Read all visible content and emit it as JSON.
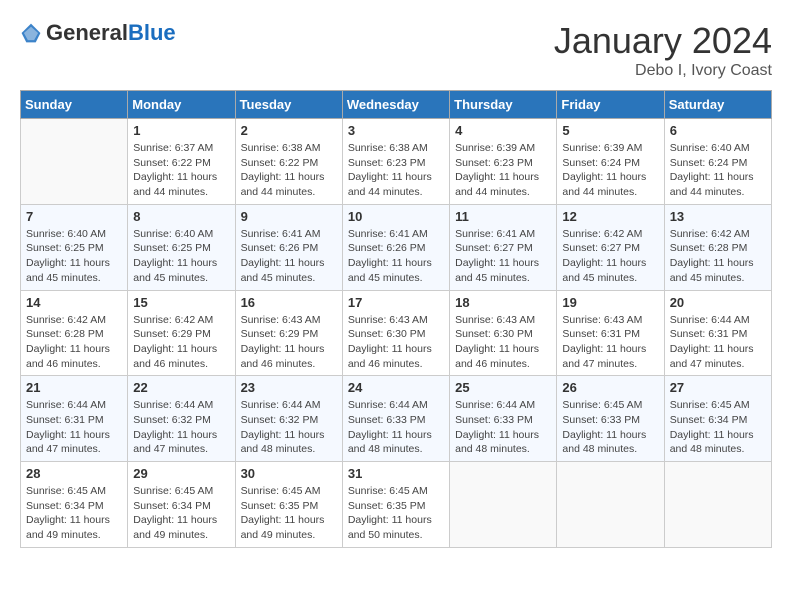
{
  "logo": {
    "text_general": "General",
    "text_blue": "Blue"
  },
  "header": {
    "month": "January 2024",
    "location": "Debo I, Ivory Coast"
  },
  "weekdays": [
    "Sunday",
    "Monday",
    "Tuesday",
    "Wednesday",
    "Thursday",
    "Friday",
    "Saturday"
  ],
  "weeks": [
    [
      {
        "day": "",
        "info": ""
      },
      {
        "day": "1",
        "info": "Sunrise: 6:37 AM\nSunset: 6:22 PM\nDaylight: 11 hours and 44 minutes."
      },
      {
        "day": "2",
        "info": "Sunrise: 6:38 AM\nSunset: 6:22 PM\nDaylight: 11 hours and 44 minutes."
      },
      {
        "day": "3",
        "info": "Sunrise: 6:38 AM\nSunset: 6:23 PM\nDaylight: 11 hours and 44 minutes."
      },
      {
        "day": "4",
        "info": "Sunrise: 6:39 AM\nSunset: 6:23 PM\nDaylight: 11 hours and 44 minutes."
      },
      {
        "day": "5",
        "info": "Sunrise: 6:39 AM\nSunset: 6:24 PM\nDaylight: 11 hours and 44 minutes."
      },
      {
        "day": "6",
        "info": "Sunrise: 6:40 AM\nSunset: 6:24 PM\nDaylight: 11 hours and 44 minutes."
      }
    ],
    [
      {
        "day": "7",
        "info": "Sunrise: 6:40 AM\nSunset: 6:25 PM\nDaylight: 11 hours and 45 minutes."
      },
      {
        "day": "8",
        "info": "Sunrise: 6:40 AM\nSunset: 6:25 PM\nDaylight: 11 hours and 45 minutes."
      },
      {
        "day": "9",
        "info": "Sunrise: 6:41 AM\nSunset: 6:26 PM\nDaylight: 11 hours and 45 minutes."
      },
      {
        "day": "10",
        "info": "Sunrise: 6:41 AM\nSunset: 6:26 PM\nDaylight: 11 hours and 45 minutes."
      },
      {
        "day": "11",
        "info": "Sunrise: 6:41 AM\nSunset: 6:27 PM\nDaylight: 11 hours and 45 minutes."
      },
      {
        "day": "12",
        "info": "Sunrise: 6:42 AM\nSunset: 6:27 PM\nDaylight: 11 hours and 45 minutes."
      },
      {
        "day": "13",
        "info": "Sunrise: 6:42 AM\nSunset: 6:28 PM\nDaylight: 11 hours and 45 minutes."
      }
    ],
    [
      {
        "day": "14",
        "info": "Sunrise: 6:42 AM\nSunset: 6:28 PM\nDaylight: 11 hours and 46 minutes."
      },
      {
        "day": "15",
        "info": "Sunrise: 6:42 AM\nSunset: 6:29 PM\nDaylight: 11 hours and 46 minutes."
      },
      {
        "day": "16",
        "info": "Sunrise: 6:43 AM\nSunset: 6:29 PM\nDaylight: 11 hours and 46 minutes."
      },
      {
        "day": "17",
        "info": "Sunrise: 6:43 AM\nSunset: 6:30 PM\nDaylight: 11 hours and 46 minutes."
      },
      {
        "day": "18",
        "info": "Sunrise: 6:43 AM\nSunset: 6:30 PM\nDaylight: 11 hours and 46 minutes."
      },
      {
        "day": "19",
        "info": "Sunrise: 6:43 AM\nSunset: 6:31 PM\nDaylight: 11 hours and 47 minutes."
      },
      {
        "day": "20",
        "info": "Sunrise: 6:44 AM\nSunset: 6:31 PM\nDaylight: 11 hours and 47 minutes."
      }
    ],
    [
      {
        "day": "21",
        "info": "Sunrise: 6:44 AM\nSunset: 6:31 PM\nDaylight: 11 hours and 47 minutes."
      },
      {
        "day": "22",
        "info": "Sunrise: 6:44 AM\nSunset: 6:32 PM\nDaylight: 11 hours and 47 minutes."
      },
      {
        "day": "23",
        "info": "Sunrise: 6:44 AM\nSunset: 6:32 PM\nDaylight: 11 hours and 48 minutes."
      },
      {
        "day": "24",
        "info": "Sunrise: 6:44 AM\nSunset: 6:33 PM\nDaylight: 11 hours and 48 minutes."
      },
      {
        "day": "25",
        "info": "Sunrise: 6:44 AM\nSunset: 6:33 PM\nDaylight: 11 hours and 48 minutes."
      },
      {
        "day": "26",
        "info": "Sunrise: 6:45 AM\nSunset: 6:33 PM\nDaylight: 11 hours and 48 minutes."
      },
      {
        "day": "27",
        "info": "Sunrise: 6:45 AM\nSunset: 6:34 PM\nDaylight: 11 hours and 48 minutes."
      }
    ],
    [
      {
        "day": "28",
        "info": "Sunrise: 6:45 AM\nSunset: 6:34 PM\nDaylight: 11 hours and 49 minutes."
      },
      {
        "day": "29",
        "info": "Sunrise: 6:45 AM\nSunset: 6:34 PM\nDaylight: 11 hours and 49 minutes."
      },
      {
        "day": "30",
        "info": "Sunrise: 6:45 AM\nSunset: 6:35 PM\nDaylight: 11 hours and 49 minutes."
      },
      {
        "day": "31",
        "info": "Sunrise: 6:45 AM\nSunset: 6:35 PM\nDaylight: 11 hours and 50 minutes."
      },
      {
        "day": "",
        "info": ""
      },
      {
        "day": "",
        "info": ""
      },
      {
        "day": "",
        "info": ""
      }
    ]
  ]
}
